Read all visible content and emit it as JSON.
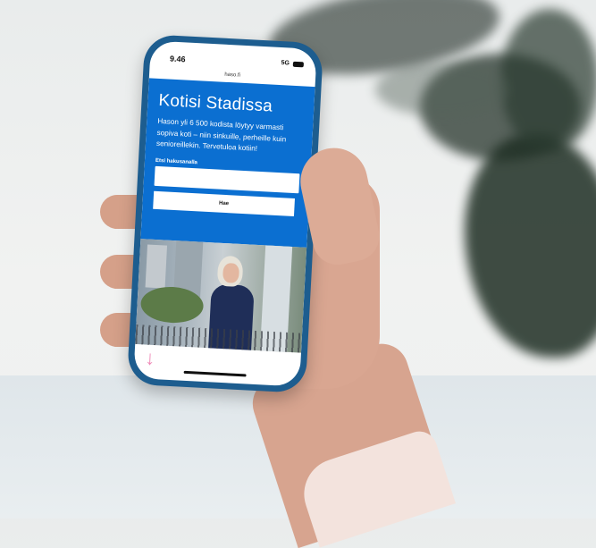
{
  "status_bar": {
    "time": "9.46",
    "network": "5G"
  },
  "browser": {
    "url": "haso.fi"
  },
  "hero": {
    "title": "Kotisi Stadissa",
    "description": "Hason yli 6 500 kodista löytyy varmasti sopiva koti – niin sinkuille, perheille kuin senioreillekin. Tervetuloa kotiin!"
  },
  "search": {
    "label": "Etsi hakusanalla",
    "value": "",
    "button_label": "Hae"
  },
  "icons": {
    "scroll_arrow": "arrow-down-icon"
  },
  "colors": {
    "brand_blue": "#0b6fd1",
    "phone_case": "#1d5d8f",
    "arrow_pink": "#ef8ab8"
  }
}
